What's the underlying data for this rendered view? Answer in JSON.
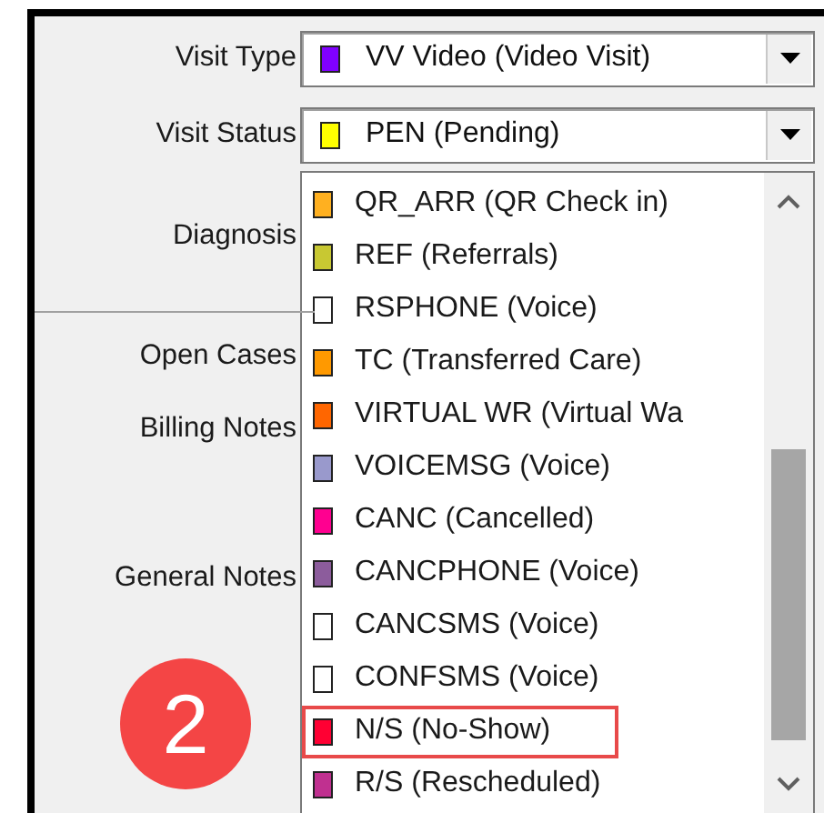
{
  "form": {
    "labels": [
      {
        "text": "Visit Type",
        "kind": "combo"
      },
      {
        "text": "Visit Status",
        "kind": "combo"
      },
      {
        "text": "Diagnosis",
        "kind": "field"
      },
      {
        "text": "Open Cases",
        "kind": "field"
      },
      {
        "text": "Billing Notes",
        "kind": "field"
      },
      {
        "text": "General Notes",
        "kind": "field"
      }
    ],
    "visit_type": {
      "value": "VV Video (Video Visit)",
      "color": "#8000ff"
    },
    "visit_status": {
      "value": "PEN (Pending)",
      "color": "#ffff00"
    }
  },
  "dropdown": {
    "items": [
      {
        "label": "QR_ARR (QR Check in)",
        "color": "#ffb020",
        "highlighted": false
      },
      {
        "label": "REF (Referrals)",
        "color": "#c8c832",
        "highlighted": false
      },
      {
        "label": "RSPHONE (Voice)",
        "color": "#ffffff",
        "highlighted": false
      },
      {
        "label": "TC (Transferred Care)",
        "color": "#ff9900",
        "highlighted": false
      },
      {
        "label": "VIRTUAL WR (Virtual Wa",
        "color": "#ff6600",
        "highlighted": false
      },
      {
        "label": "VOICEMSG (Voice)",
        "color": "#9999cc",
        "highlighted": false
      },
      {
        "label": "CANC (Cancelled)",
        "color": "#ff0090",
        "highlighted": false
      },
      {
        "label": "CANCPHONE (Voice)",
        "color": "#8c5c9c",
        "highlighted": false
      },
      {
        "label": "CANCSMS (Voice)",
        "color": "#ffffff",
        "highlighted": false
      },
      {
        "label": "CONFSMS (Voice)",
        "color": "#ffffff",
        "highlighted": false
      },
      {
        "label": "N/S (No-Show)",
        "color": "#ff0033",
        "highlighted": true
      },
      {
        "label": "R/S (Rescheduled)",
        "color": "#c03090",
        "highlighted": false
      }
    ]
  },
  "step_badge": "2"
}
